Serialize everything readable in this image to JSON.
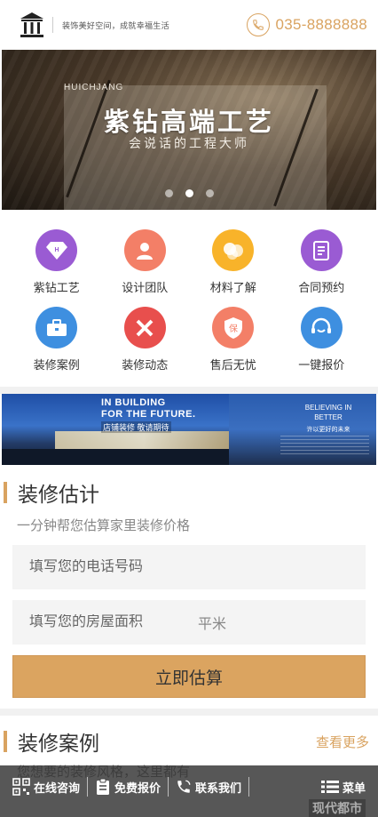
{
  "header": {
    "slogan": "装饰美好空间，成就幸福生活",
    "phone": "035-8888888",
    "brand_color": "#d9a360"
  },
  "banner": {
    "brand_small": "HUICHJANG",
    "title": "紫钻高端工艺",
    "subtitle": "会说话的工程大师",
    "slides": 3,
    "active_slide": 2
  },
  "menu": [
    {
      "label": "紫钻工艺",
      "icon": "diamond-icon",
      "color": "#9a5bd3"
    },
    {
      "label": "设计团队",
      "icon": "person-icon",
      "color": "#f37f67"
    },
    {
      "label": "材料了解",
      "icon": "circles-icon",
      "color": "#f8b32a"
    },
    {
      "label": "合同预约",
      "icon": "document-icon",
      "color": "#9a5bd3"
    },
    {
      "label": "装修案例",
      "icon": "briefcase-icon",
      "color": "#3e8fe0"
    },
    {
      "label": "装修动态",
      "icon": "ruler-pencil-icon",
      "color": "#e84f4d"
    },
    {
      "label": "售后无忧",
      "icon": "shield-icon",
      "color": "#f37f67"
    },
    {
      "label": "一键报价",
      "icon": "headset-icon",
      "color": "#3e8fe0"
    }
  ],
  "promo": {
    "line1": "IN BUILDING",
    "line2": "FOR THE FUTURE.",
    "line3": "店铺装修 敬请期待",
    "right1": "BELIEVING IN BETTER",
    "right2": "许以更好的未来"
  },
  "estimate": {
    "title": "装修估计",
    "subtitle": "一分钟帮您估算家里装修价格",
    "phone_placeholder": "填写您的电话号码",
    "area_placeholder": "填写您的房屋面积",
    "area_unit": "平米",
    "submit_label": "立即估算"
  },
  "cases": {
    "title": "装修案例",
    "more_label": "查看更多",
    "subtitle": "您想要的装修风格，这里都有"
  },
  "bottom_bar": {
    "consult": "在线咨询",
    "quote": "免费报价",
    "contact": "联系我们",
    "menu": "菜单",
    "watermark": "现代都市"
  }
}
